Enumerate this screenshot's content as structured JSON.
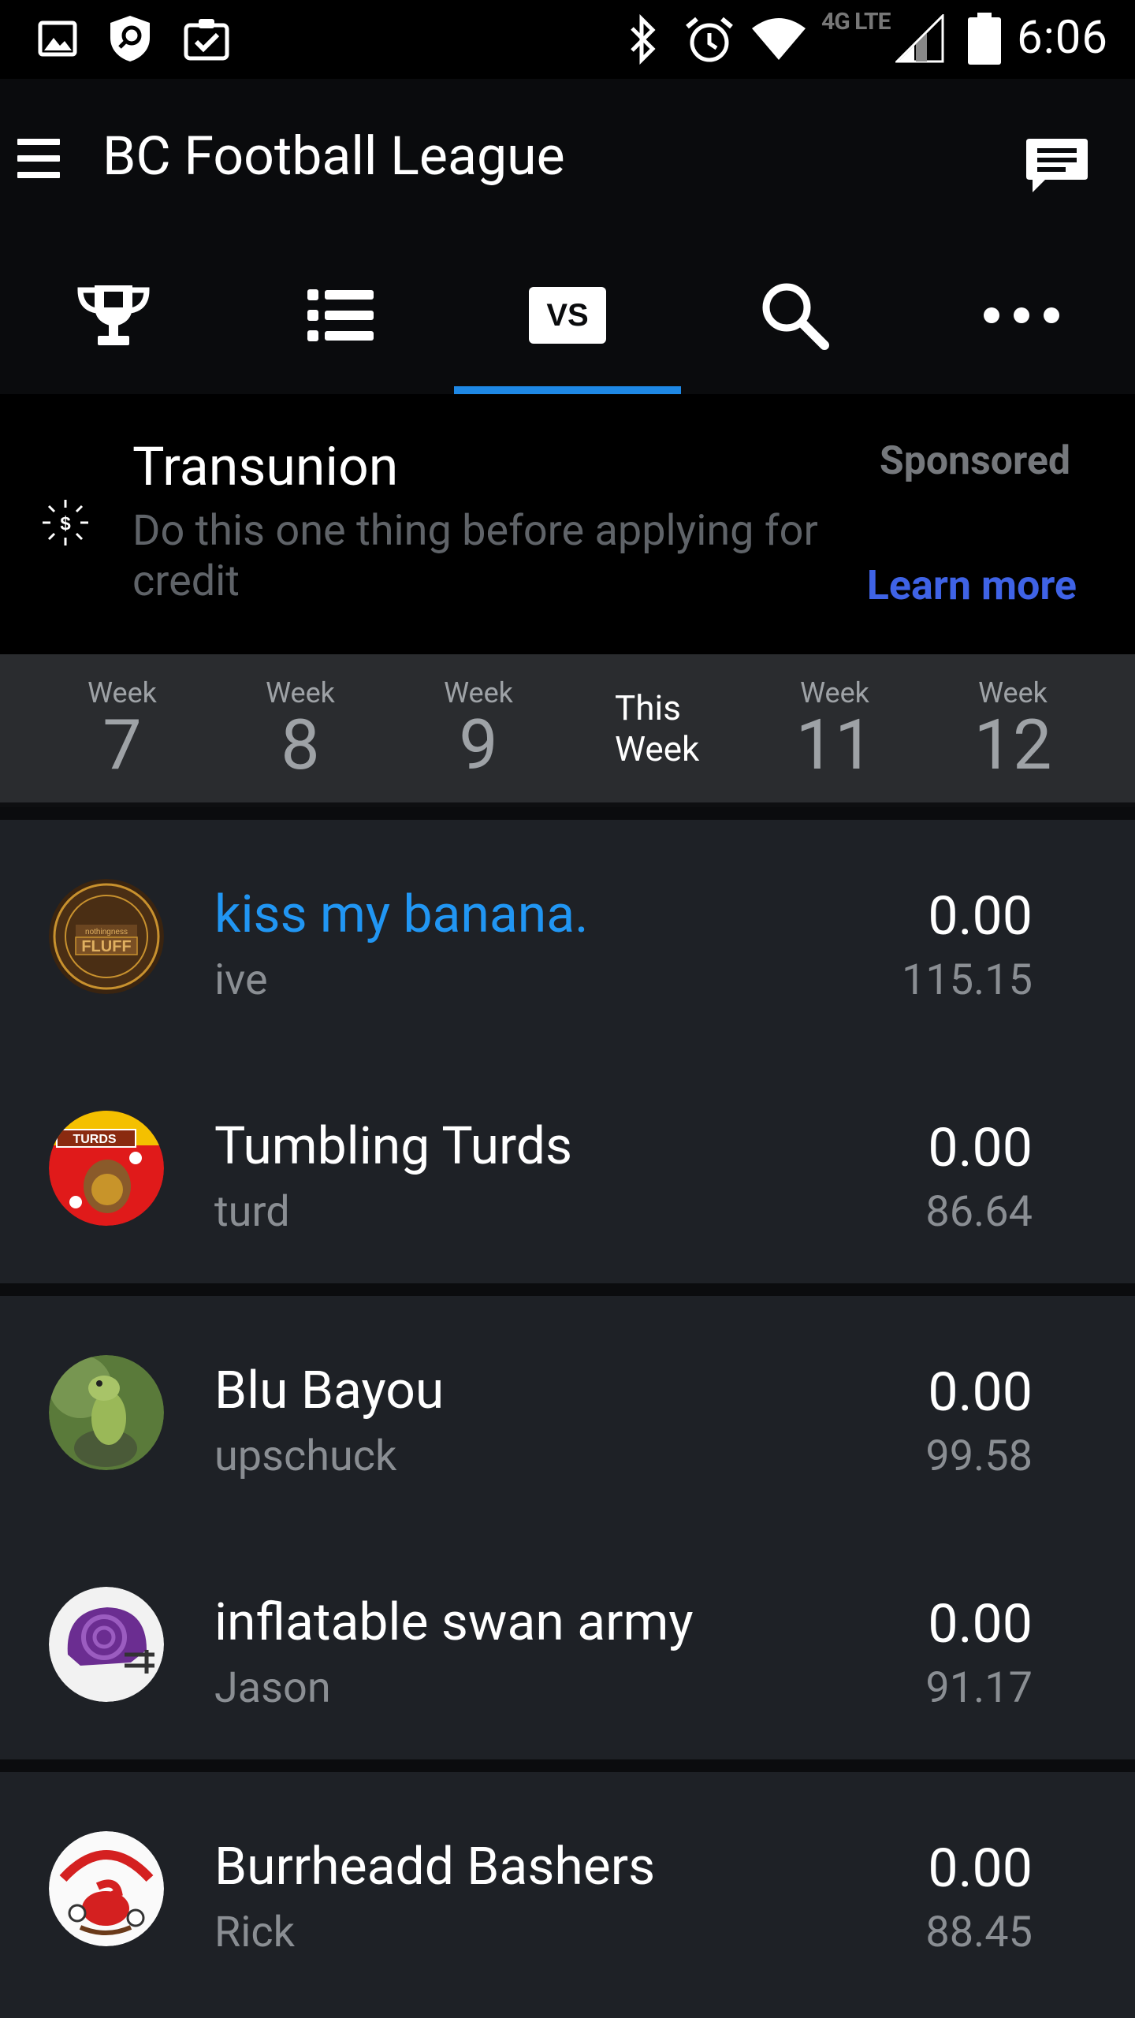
{
  "status_bar": {
    "time": "6:06",
    "network": "4G LTE",
    "left_icons": [
      "image-icon",
      "shield-search-icon",
      "clipboard-check-icon"
    ],
    "right_icons": [
      "bluetooth-icon",
      "alarm-icon",
      "wifi-icon",
      "signal-icon",
      "battery-icon"
    ]
  },
  "app_bar": {
    "title": "BC Football League",
    "menu_icon": "hamburger-menu-icon",
    "chat_icon": "chat-icon"
  },
  "tabs": [
    {
      "icon": "trophy-icon",
      "active": false
    },
    {
      "icon": "list-icon",
      "active": false
    },
    {
      "icon": "vs-icon",
      "label": "VS",
      "active": true
    },
    {
      "icon": "search-icon",
      "active": false
    },
    {
      "icon": "more-icon",
      "active": false
    }
  ],
  "ad": {
    "advertiser": "Transunion",
    "body": "Do this one thing before applying for credit",
    "sponsored_label": "Sponsored",
    "cta": "Learn more",
    "cta_color": "#3f63e6"
  },
  "weeks": [
    {
      "label": "Week",
      "number": "7"
    },
    {
      "label": "Week",
      "number": "8"
    },
    {
      "label": "Week",
      "number": "9"
    },
    {
      "label": "This\nWeek",
      "number": "",
      "current": true
    },
    {
      "label": "Week",
      "number": "11"
    },
    {
      "label": "Week",
      "number": "12"
    }
  ],
  "matchups": [
    {
      "teams": [
        {
          "name": "kiss my banana.",
          "owner": "ive",
          "score": "0.00",
          "projected": "115.15",
          "is_user": true
        },
        {
          "name": "Tumbling Turds",
          "owner": "turd",
          "score": "0.00",
          "projected": "86.64",
          "is_user": false
        }
      ]
    },
    {
      "teams": [
        {
          "name": "Blu Bayou",
          "owner": "upschuck",
          "score": "0.00",
          "projected": "99.58",
          "is_user": false
        },
        {
          "name": "inflatable swan army",
          "owner": "Jason",
          "score": "0.00",
          "projected": "91.17",
          "is_user": false
        }
      ]
    },
    {
      "teams": [
        {
          "name": "Burrheadd Bashers",
          "owner": "Rick",
          "score": "0.00",
          "projected": "88.45",
          "is_user": false
        }
      ]
    }
  ],
  "colors": {
    "accent": "#1e88e5",
    "user_team": "#2196f3",
    "background": "#1e2126"
  }
}
